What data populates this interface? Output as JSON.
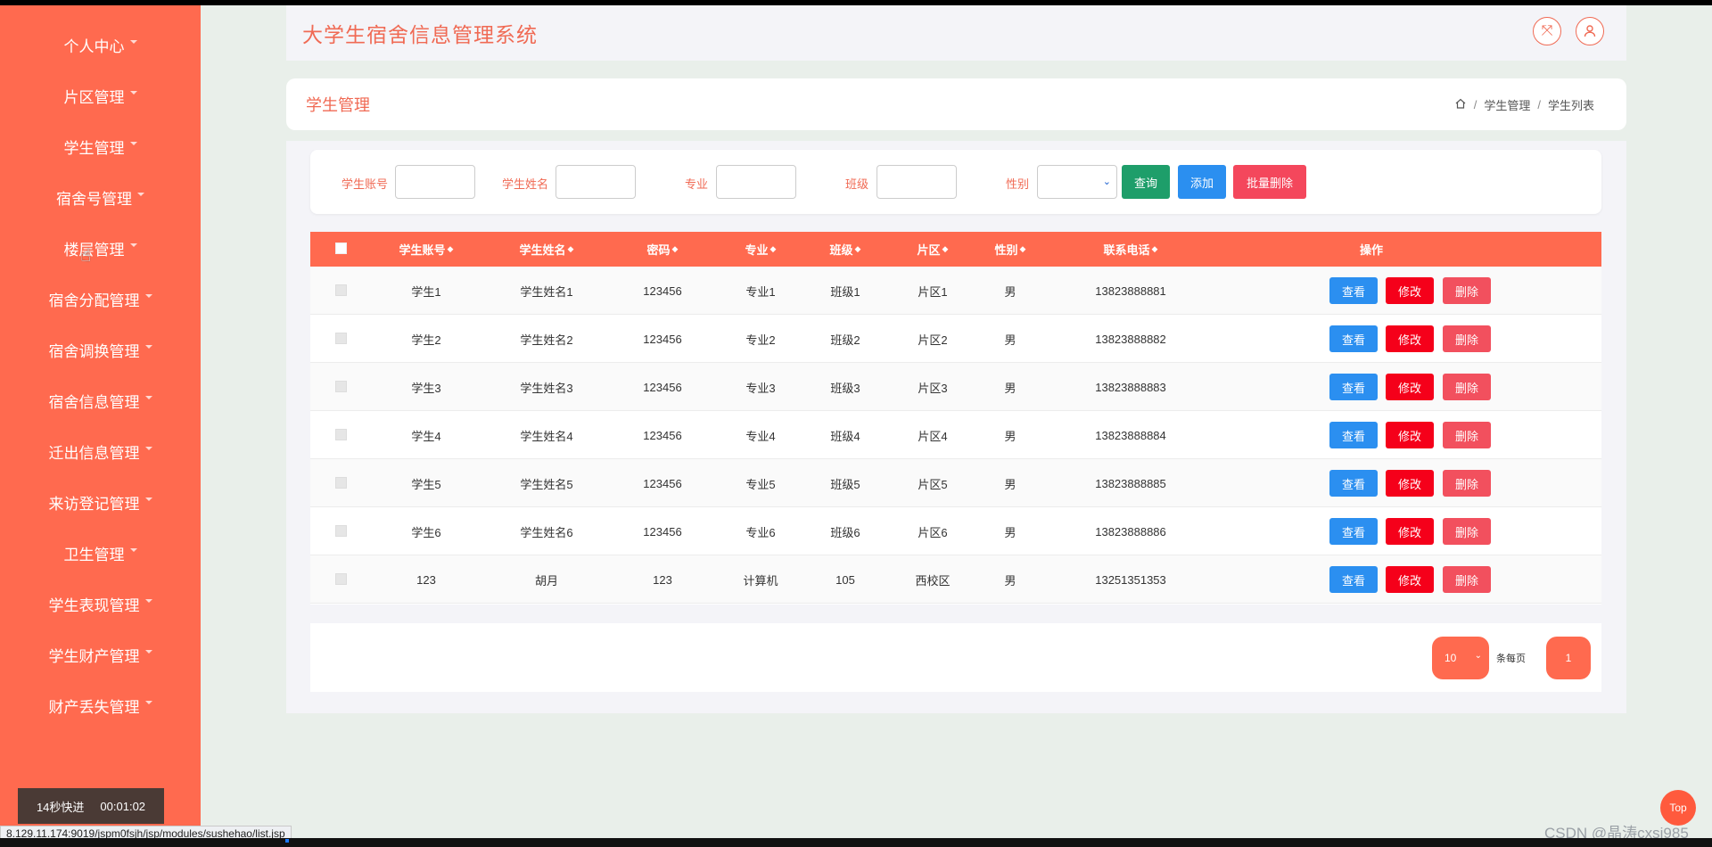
{
  "app": {
    "title": "大学生宿舍信息管理系统"
  },
  "sidebar": {
    "items": [
      {
        "label": "个人中心"
      },
      {
        "label": "片区管理"
      },
      {
        "label": "学生管理"
      },
      {
        "label": "宿舍号管理"
      },
      {
        "label": "楼层管理"
      },
      {
        "label": "宿舍分配管理"
      },
      {
        "label": "宿舍调换管理"
      },
      {
        "label": "宿舍信息管理"
      },
      {
        "label": "迁出信息管理"
      },
      {
        "label": "来访登记管理"
      },
      {
        "label": "卫生管理"
      },
      {
        "label": "学生表现管理"
      },
      {
        "label": "学生财产管理"
      },
      {
        "label": "财产丢失管理"
      }
    ]
  },
  "header": {
    "icons": [
      "fullscreen-icon",
      "user-icon"
    ]
  },
  "breadcrumb": {
    "page_title": "学生管理",
    "home_icon": "home-icon",
    "crumb1": "学生管理",
    "crumb2": "学生列表",
    "sep": "/"
  },
  "search": {
    "account_label": "学生账号",
    "name_label": "学生姓名",
    "major_label": "专业",
    "class_label": "班级",
    "gender_label": "性别",
    "gender_value": "",
    "query_btn": "查询",
    "add_btn": "添加",
    "batch_delete_btn": "批量删除"
  },
  "table": {
    "headers": {
      "account": "学生账号",
      "name": "学生姓名",
      "password": "密码",
      "major": "专业",
      "class": "班级",
      "area": "片区",
      "gender": "性别",
      "phone": "联系电话",
      "actions": "操作"
    },
    "sort_glyph": "◆",
    "rows": [
      {
        "account": "学生1",
        "name": "学生姓名1",
        "password": "123456",
        "major": "专业1",
        "class": "班级1",
        "area": "片区1",
        "gender": "男",
        "phone": "13823888881"
      },
      {
        "account": "学生2",
        "name": "学生姓名2",
        "password": "123456",
        "major": "专业2",
        "class": "班级2",
        "area": "片区2",
        "gender": "男",
        "phone": "13823888882"
      },
      {
        "account": "学生3",
        "name": "学生姓名3",
        "password": "123456",
        "major": "专业3",
        "class": "班级3",
        "area": "片区3",
        "gender": "男",
        "phone": "13823888883"
      },
      {
        "account": "学生4",
        "name": "学生姓名4",
        "password": "123456",
        "major": "专业4",
        "class": "班级4",
        "area": "片区4",
        "gender": "男",
        "phone": "13823888884"
      },
      {
        "account": "学生5",
        "name": "学生姓名5",
        "password": "123456",
        "major": "专业5",
        "class": "班级5",
        "area": "片区5",
        "gender": "男",
        "phone": "13823888885"
      },
      {
        "account": "学生6",
        "name": "学生姓名6",
        "password": "123456",
        "major": "专业6",
        "class": "班级6",
        "area": "片区6",
        "gender": "男",
        "phone": "13823888886"
      },
      {
        "account": "123",
        "name": "胡月",
        "password": "123",
        "major": "计算机",
        "class": "105",
        "area": "西校区",
        "gender": "男",
        "phone": "13251351353"
      }
    ],
    "row_actions": {
      "view": "查看",
      "edit": "修改",
      "delete": "删除"
    }
  },
  "pagination": {
    "page_size": "10",
    "per_page_label": "条每页",
    "current_page": "1"
  },
  "overlays": {
    "timer_label": "14秒快进",
    "timer_time": "00:01:02",
    "status_url": "8.129.11.174:9019/jspm0fsjh/jsp/modules/sushehao/list.jsp",
    "top_button": "Top",
    "watermark": "CSDN @晶涛cxsj985"
  },
  "colors": {
    "primary": "#ff6a4f",
    "title": "#f06a54",
    "query": "#1e9e6a",
    "add": "#2b8ff0",
    "batch_delete": "#f4475c",
    "view": "#2b8ff0",
    "edit": "#f5001a",
    "delete": "#f2505e"
  }
}
